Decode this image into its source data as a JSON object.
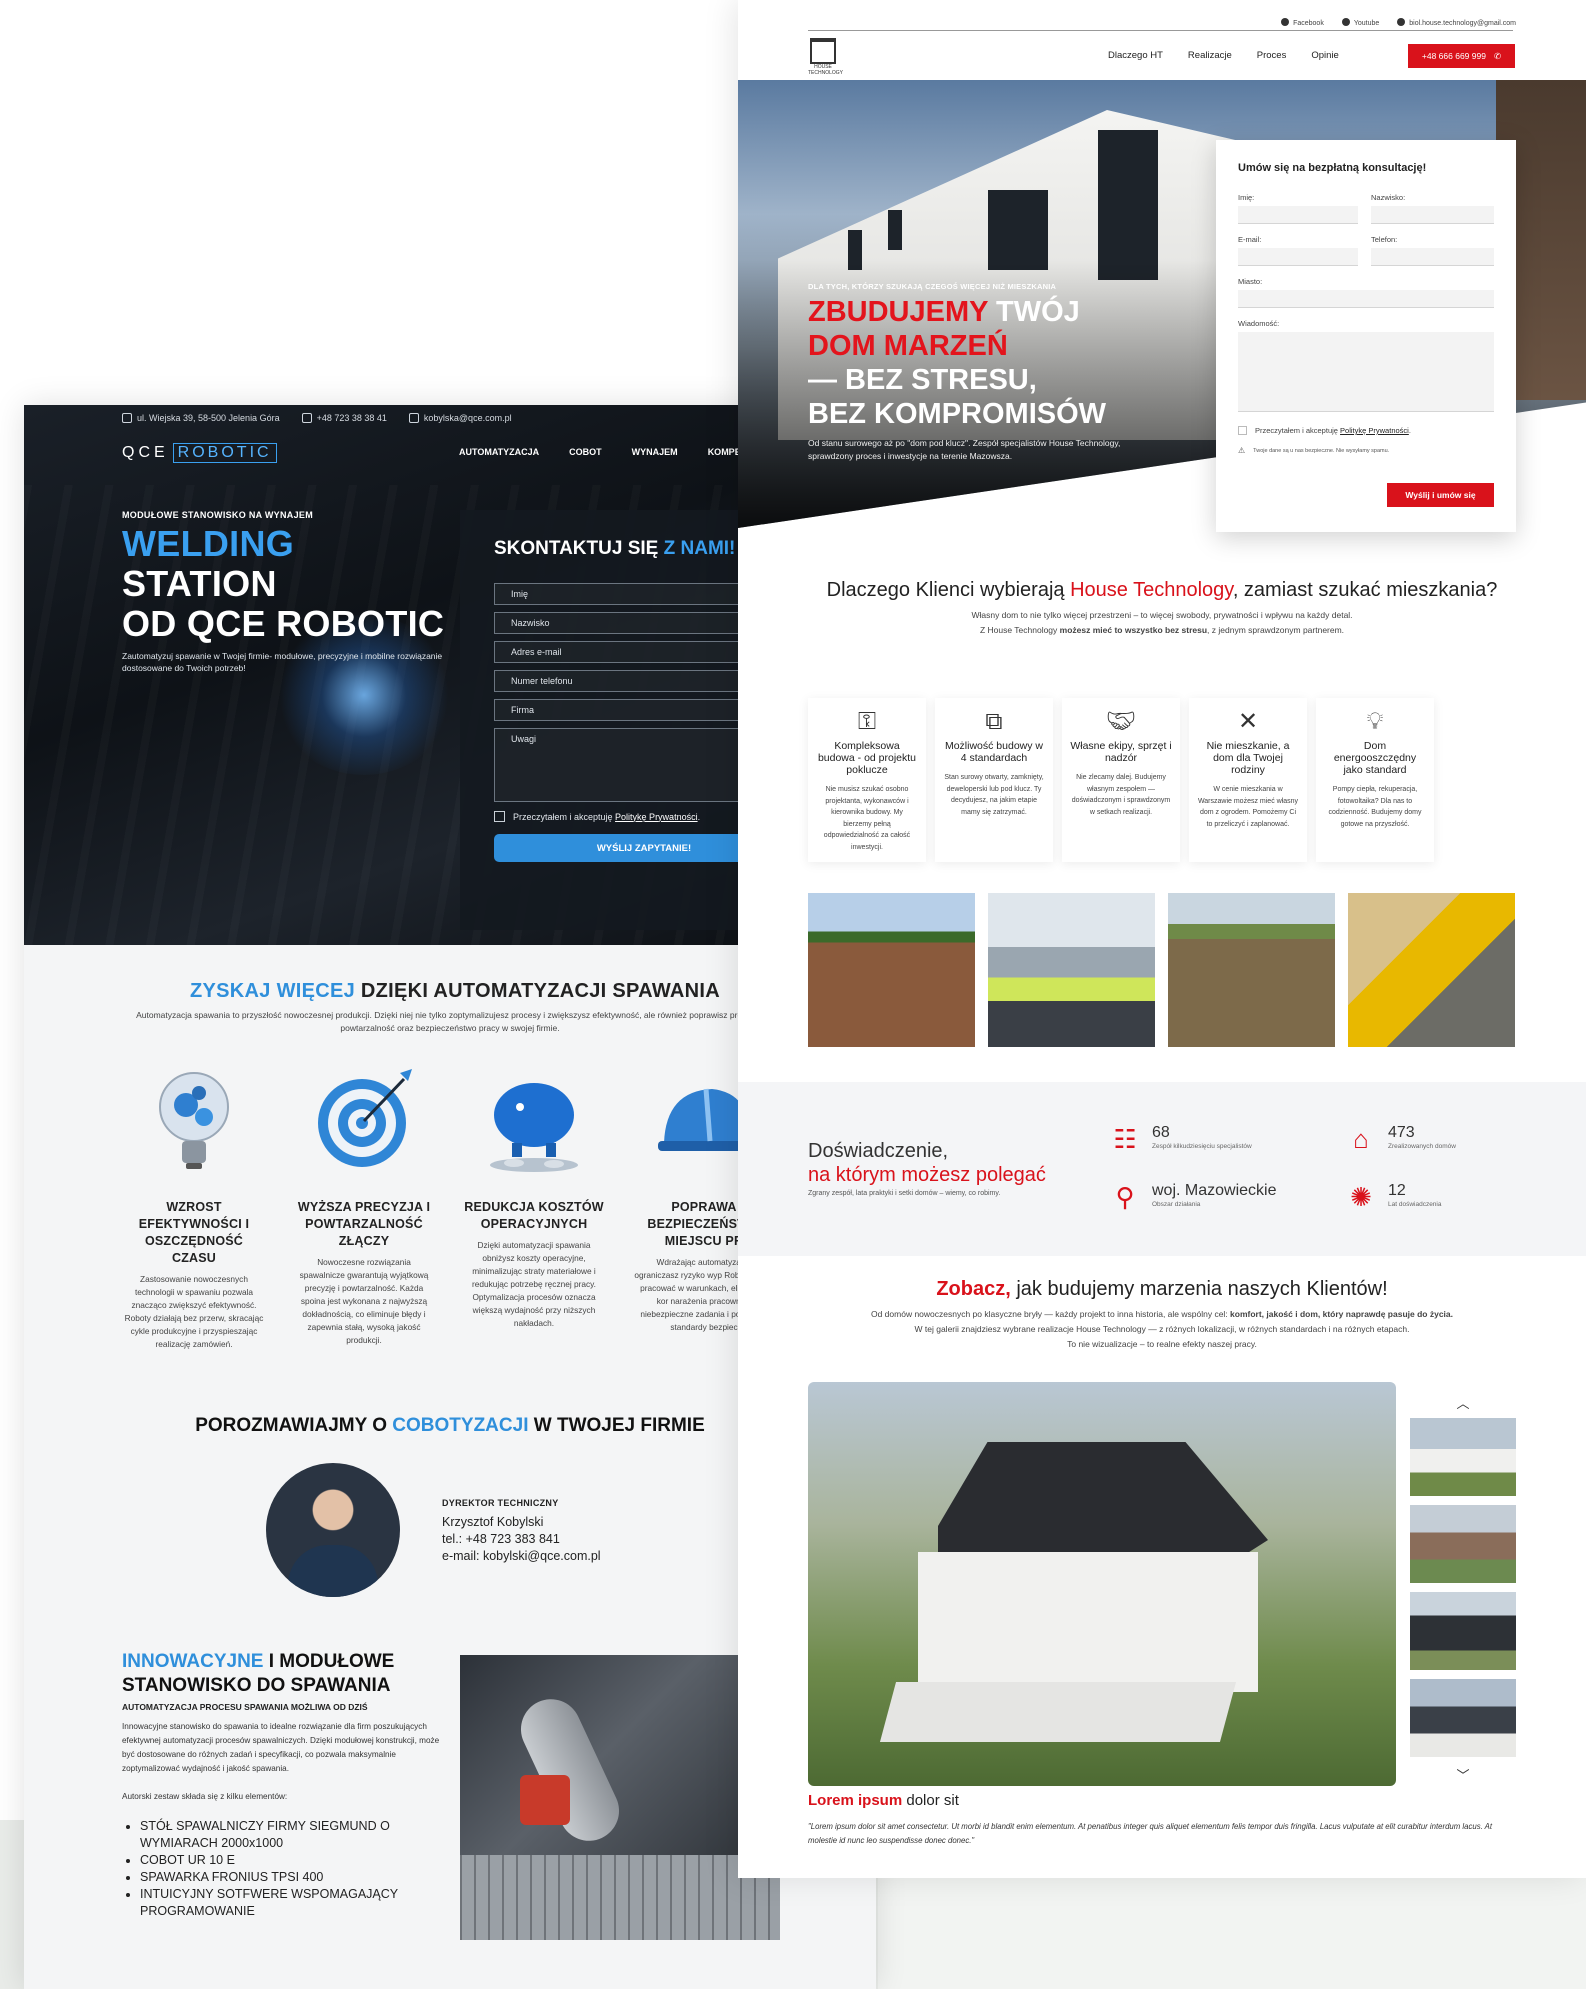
{
  "qce": {
    "topbar": {
      "address": "ul. Wiejska 39, 58-500 Jelenia Góra",
      "phone": "+48 723 38 38 41",
      "email": "kobylska@qce.com.pl"
    },
    "logo": {
      "left": "QCE",
      "box": "ROBOTIC"
    },
    "menu": [
      "AUTOMATYZACJA",
      "COBOT",
      "WYNAJEM",
      "KOMPETE"
    ],
    "hero": {
      "kicker": "MODUŁOWE STANOWISKO NA WYNAJEM",
      "title_blue": "WELDING",
      "title_line1_rest": " STATION",
      "title_line2": "OD QCE ROBOTIC",
      "desc": "Zautomatyzuj spawanie w Twojej firmie- modułowe, precyzyjne i mobilne rozwiązanie dostosowane do Twoich potrzeb!"
    },
    "form": {
      "title_white": "SKONTAKTUJ SIĘ",
      "title_blue": " Z NAMI!",
      "fields": [
        "Imię",
        "Nazwisko",
        "Adres e-mail",
        "Numer telefonu",
        "Firma",
        "Uwagi"
      ],
      "consent_text": "Przeczytałem i akceptuję ",
      "consent_link": "Politykę Prywatności",
      "consent_end": ".",
      "submit": "WYŚLIJ ZAPYTANIE!"
    },
    "section1": {
      "title_blue": "ZYSKAJ WIĘCEJ",
      "title_rest": " DZIĘKI AUTOMATYZACJI SPAWANIA",
      "desc": "Automatyzacja spawania to przyszłość nowoczesnej produkcji. Dzięki niej nie tylko zoptymalizujesz procesy i zwiększysz efektywność, ale również poprawisz precyzję, powtarzalność oraz bezpieczeństwo pracy w swojej firmie."
    },
    "features": [
      {
        "icon": "lightbulb-gears-icon",
        "title": "WZROST EFEKTYWNOŚCI I OSZCZĘDNOŚĆ CZASU",
        "text": "Zastosowanie nowoczesnych technologii w spawaniu pozwala znacząco zwiększyć efektywność. Roboty działają bez przerw, skracając cykle produkcyjne i przyspieszając realizację zamówień."
      },
      {
        "icon": "target-icon",
        "title": "WYŻSZA PRECYZJA I POWTARZALNOŚĆ ZŁĄCZY",
        "text": "Nowoczesne rozwiązania spawalnicze gwarantują wyjątkową precyzję i powtarzalność. Każda spoina jest wykonana z najwyższą dokładnością, co eliminuje błędy i zapewnia stałą, wysoką jakość produkcji."
      },
      {
        "icon": "piggy-bank-icon",
        "title": "REDUKCJA KOSZTÓW OPERACYJNYCH",
        "text": "Dzięki automatyzacji spawania obniżysz koszty operacyjne, minimalizując straty materiałowe i redukując potrzebę ręcznej pracy. Optymalizacja procesów oznacza większą wydajność przy niższych nakładach."
      },
      {
        "icon": "helmet-icon",
        "title": "POPRAWA BEZPIECZEŃST W MIEJSCU PR",
        "text": "Wdrażając automatyzację ograniczasz ryzyko wyp Roboty mogą pracować w warunkach, eliminując kor narażenia pracownikó niebezpieczne zadania i po ogólne standardy bezpiec"
      }
    ],
    "talk": {
      "title_start": "POROZMAWIAJMY O ",
      "title_blue": "COBOTYZACJI",
      "title_end": " W TWOJEJ FIRMIE"
    },
    "person": {
      "role": "DYREKTOR TECHNICZNY",
      "name": "Krzysztof Kobylski",
      "phone": "tel.: +48 723 383 841",
      "email": "e-mail: kobylski@qce.com.pl"
    },
    "section3": {
      "title_blue": "INNOWACYJNE",
      "title_rest": " I MODUŁOWE STANOWISKO DO SPAWANIA",
      "sub": "AUTOMATYZACJA PROCESU SPAWANIA MOŻLIWA OD DZIŚ",
      "p1": "Innowacyjne stanowisko do spawania to idealne rozwiązanie dla firm poszukujących efektywnej automatyzacji procesów spawalniczych. Dzięki modułowej konstrukcji, może być dostosowane do różnych zadań i specyfikacji, co pozwala maksymalnie zoptymalizować wydajność i jakość spawania.",
      "p2": "Autorski zestaw składa się z kilku elementów:",
      "list": [
        "STÓŁ SPAWALNICZY FIRMY SIEGMUND O WYMIARACH 2000x1000",
        "COBOT UR 10 E",
        "SPAWARKA FRONIUS TPSI 400",
        "INTUICYJNY SOTFWERE WSPOMAGAJĄCY PROGRAMOWANIE"
      ]
    }
  },
  "ht": {
    "social": [
      "Facebook",
      "Youtube",
      "biol.house.technology@gmail.com"
    ],
    "logo_text": "HOUSE TECHNOLOGY",
    "nav": [
      "Dlaczego HT",
      "Realizacje",
      "Proces",
      "Opinie"
    ],
    "phone": "+48 666 669 999",
    "hero": {
      "kicker": "DLA TYCH, KTÓRZY SZUKAJĄ CZEGOŚ WIĘCEJ NIŻ MIESZKANIA",
      "title_red": "ZBUDUJEMY",
      "title_after_red": " TWÓJ",
      "title_red2": "DOM MARZEŃ",
      "title_line3": "— BEZ STRESU,",
      "title_line4": "BEZ KOMPROMISÓW",
      "desc": "Od stanu surowego aż po \"dom pod klucz\". Zespół specjalistów House Technology, sprawdzony proces i inwestycje na terenie Mazowsza."
    },
    "form": {
      "title": "Umów się na bezpłatną konsultację!",
      "labels": [
        "Imię:",
        "Nazwisko:",
        "E-mail:",
        "Telefon:",
        "Miasto:",
        "Wiadomość:"
      ],
      "consent_text": "Przeczytałem i akceptuję ",
      "consent_link": "Politykę Prywatności",
      "consent_end": ".",
      "note": "Twoje dane są u nas bezpieczne. Nie wysyłamy spamu.",
      "submit": "Wyślij i umów się"
    },
    "why": {
      "title_start": "Dlaczego Klienci wybierają ",
      "title_red": "House Technology",
      "title_line2": ", zamiast szukać mieszkania?",
      "desc1": "Własny dom to nie tylko więcej przestrzeni – to więcej swobody, prywatności i wpływu na każdy detal.",
      "desc2_start": "Z House Technology ",
      "desc2_bold": "możesz mieć to wszystko bez stresu",
      "desc2_end": ", z jednym sprawdzonym partnerem."
    },
    "cards": [
      {
        "icon": "key-icon",
        "glyph": "⚿",
        "title": "Kompleksowa budowa - od projektu pokluczе",
        "text": "Nie musisz szukać osobno projektanta, wykonawców i kierownika budowy. My bierzemy pełną odpowiedzialność za całość inwestycji."
      },
      {
        "icon": "puzzle-icon",
        "glyph": "⧉",
        "title": "Możliwość budowy w 4 standardach",
        "text": "Stan surowy otwarty, zamknięty, deweloperski lub pod klucz. Ty decydujesz, na jakim etapie mamy się zatrzymać."
      },
      {
        "icon": "handshake-icon",
        "glyph": "🤝︎",
        "title": "Własne ekipy, sprzęt i nadzór",
        "text": "Nie zlecamy dalej. Budujemy własnym zespołem — doświadczonym i sprawdzonym w setkach realizacji."
      },
      {
        "icon": "tools-icon",
        "glyph": "✕",
        "title": "Nie mieszkanie, a dom dla Twojej rodziny",
        "text": "W cenie mieszkania w Warszawie możesz mieć własny dom z ogrodem. Pomożemy Ci to przeliczyć i zaplanować."
      },
      {
        "icon": "eco-bulb-icon",
        "glyph": "💡︎",
        "title": "Dom energooszczędny jako standard",
        "text": "Pompy ciepła, rekuperacja, fotowoltaika? Dla nas to codzienność. Budujemy domy gotowe na przyszłość."
      }
    ],
    "stats": {
      "title_line1": "Doświadczenie,",
      "title_red": "na którym możesz polegać",
      "sub": "Zgrany zespół, lata praktyki i setki domów – wiemy, co robimy.",
      "items": [
        {
          "icon": "team-icon",
          "glyph": "☷",
          "value": "68",
          "label": "Zespół kilkudziesięciu specjalistów"
        },
        {
          "icon": "house-icon",
          "glyph": "⌂",
          "value": "473",
          "label": "Zrealizowanych domów"
        },
        {
          "icon": "location-pin-icon",
          "glyph": "⚲",
          "value": "woj. Mazowieckie",
          "label": "Obszar działania"
        },
        {
          "icon": "award-icon",
          "glyph": "✺",
          "value": "12",
          "label": "Lat doświadczenia"
        }
      ]
    },
    "gallery": {
      "title_red": "Zobacz,",
      "title_rest": "  jak budujemy marzenia naszych Klientów!",
      "p1_start": "Od domów nowoczesnych po klasyczne bryły — każdy projekt to inna historia, ale wspólny cel: ",
      "p1_bold": "komfort, jakość i dom, który naprawdę pasuje do życia.",
      "p2": "W tej galerii znajdziesz wybrane realizacje House Technology — z różnych lokalizacji, w różnych standardach i na różnych etapach.",
      "p3": "To nie wizualizacje – to realne efekty naszej pracy.",
      "caption_red": "Lorem ipsum",
      "caption_rest": " dolor sit",
      "quote": "\"Lorem ipsum dolor sit amet consectetur. Ut morbi id blandit enim elementum. At penatibus integer quis aliquet elementum felis tempor duis fringilla. Lacus vulputate at elit curabitur interdum lacus. At molestie id nunc leo suspendisse donec donec.\""
    }
  }
}
